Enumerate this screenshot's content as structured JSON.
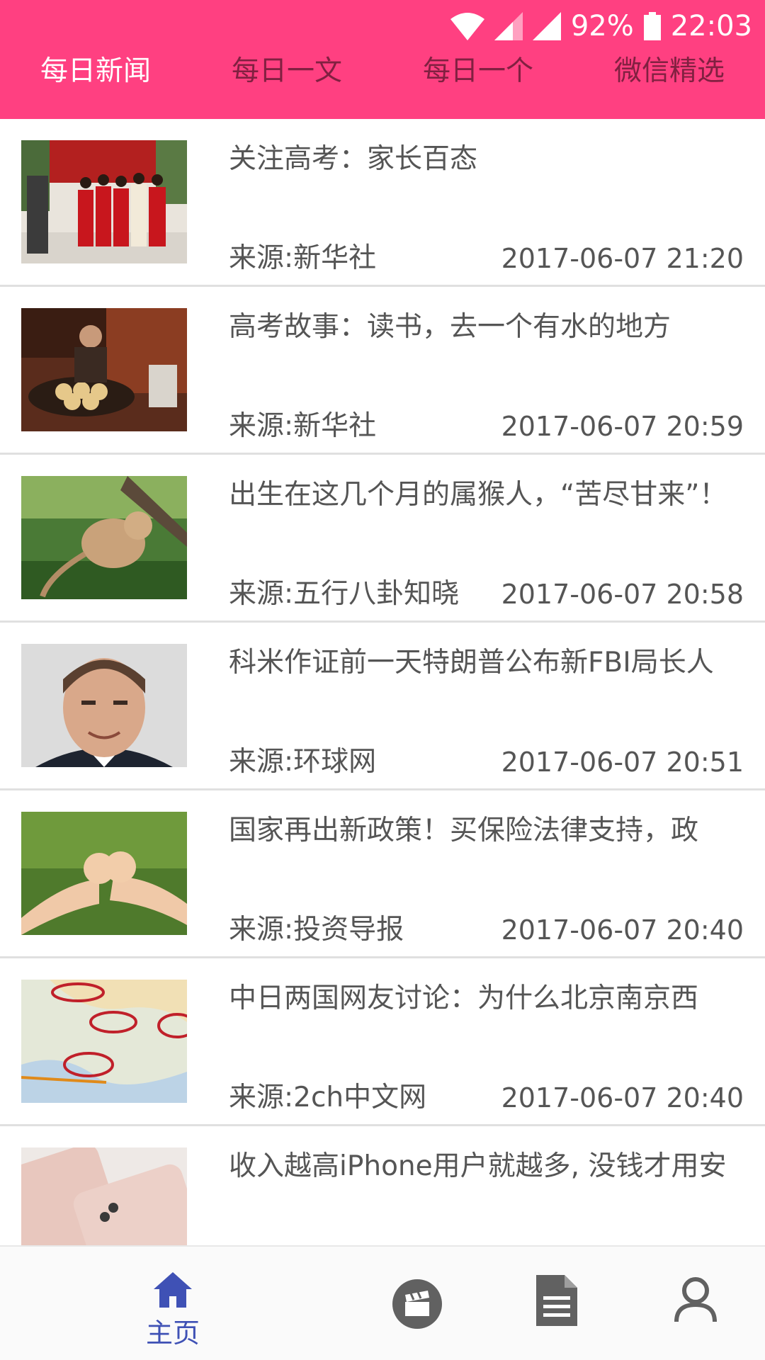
{
  "status_bar": {
    "battery": "92%",
    "time": "22:03",
    "icons": [
      "wifi-icon",
      "signal-icon",
      "signal-icon",
      "battery-icon"
    ]
  },
  "tabs": [
    {
      "label": "每日新闻",
      "active": true
    },
    {
      "label": "每日一文",
      "active": false
    },
    {
      "label": "每日一个",
      "active": false
    },
    {
      "label": "微信精选",
      "active": false
    }
  ],
  "news": [
    {
      "title": "关注高考：家长百态",
      "source": "来源:新华社",
      "time": "2017-06-07 21:20",
      "image": "parents-in-red-photo"
    },
    {
      "title": "高考故事：读书，去一个有水的地方",
      "source": "来源:新华社",
      "time": "2017-06-07 20:59",
      "image": "woman-with-steamed-buns-photo"
    },
    {
      "title": "出生在这几个月的属猴人，“苦尽甘来”！",
      "source": "来源:五行八卦知晓",
      "time": "2017-06-07 20:58",
      "image": "monkey-on-branch-photo"
    },
    {
      "title": "科米作证前一天特朗普公布新FBI局长人",
      "source": "来源:环球网",
      "time": "2017-06-07 20:51",
      "image": "man-portrait-photo"
    },
    {
      "title": "国家再出新政策！买保险法律支持，政",
      "source": "来源:投资导报",
      "time": "2017-06-07 20:40",
      "image": "pinky-promise-photo"
    },
    {
      "title": "中日两国网友讨论：为什么北京南京西",
      "source": "来源:2ch中文网",
      "time": "2017-06-07 20:40",
      "image": "map-with-circles-photo"
    },
    {
      "title": "收入越高iPhone用户就越多, 没钱才用安",
      "source": "",
      "time": "",
      "image": "rose-gold-iphones-photo"
    }
  ],
  "bottom_nav": [
    {
      "label": "主页",
      "icon": "home-icon",
      "active": true
    },
    {
      "label": "",
      "icon": "movie-clapper-icon",
      "active": false
    },
    {
      "label": "",
      "icon": "document-icon",
      "active": false
    },
    {
      "label": "",
      "icon": "person-icon",
      "active": false
    }
  ],
  "colors": {
    "header": "#FF4081",
    "nav_active": "#3F51B5",
    "nav_inactive": "#616161",
    "text": "#555555"
  }
}
